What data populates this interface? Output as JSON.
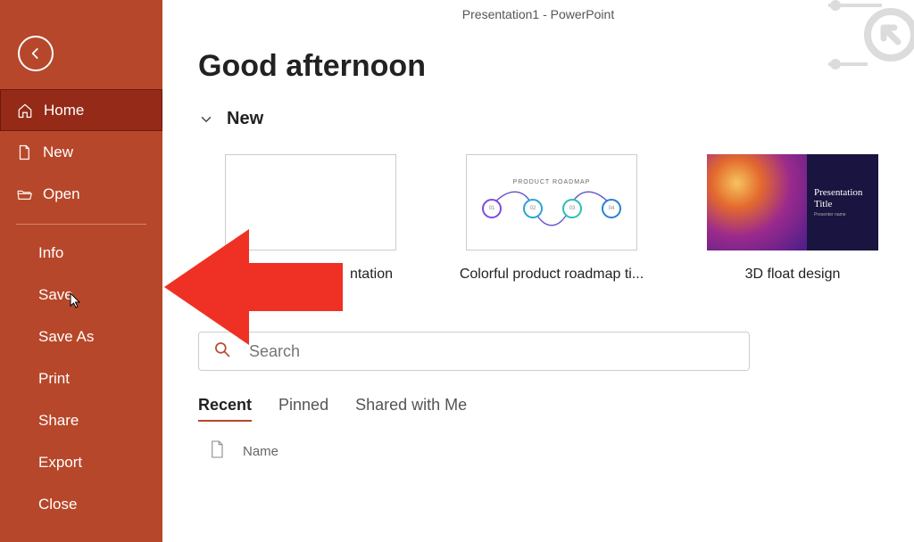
{
  "titlebar": "Presentation1  -  PowerPoint",
  "greeting": "Good afternoon",
  "section_new_label": "New",
  "sidebar": {
    "items_top": [
      {
        "label": "Home",
        "icon": "home"
      },
      {
        "label": "New",
        "icon": "file"
      },
      {
        "label": "Open",
        "icon": "folder"
      }
    ],
    "items_bottom": [
      {
        "label": "Info"
      },
      {
        "label": "Save"
      },
      {
        "label": "Save As"
      },
      {
        "label": "Print"
      },
      {
        "label": "Share"
      },
      {
        "label": "Export"
      },
      {
        "label": "Close"
      }
    ],
    "active_index": 0
  },
  "templates": [
    {
      "title_visible_fragment": "ntation",
      "full_title_hint": "Blank Presentation",
      "kind": "blank"
    },
    {
      "title": "Colorful product roadmap ti...",
      "kind": "roadmap",
      "thumb_heading": "PRODUCT  ROADMAP"
    },
    {
      "title": "3D float design",
      "kind": "floatdesign",
      "thumb_title": "Presentation Title"
    }
  ],
  "search": {
    "placeholder": "Search"
  },
  "tabs": [
    {
      "label": "Recent",
      "active": true
    },
    {
      "label": "Pinned",
      "active": false
    },
    {
      "label": "Shared with Me",
      "active": false
    }
  ],
  "list": {
    "header_name": "Name"
  },
  "colors": {
    "brand": "#b7472a",
    "brand_dark": "#952a18",
    "annotation_red": "#ee3124"
  },
  "annotation": {
    "kind": "left-arrow",
    "points_to": "sidebar Save item"
  }
}
